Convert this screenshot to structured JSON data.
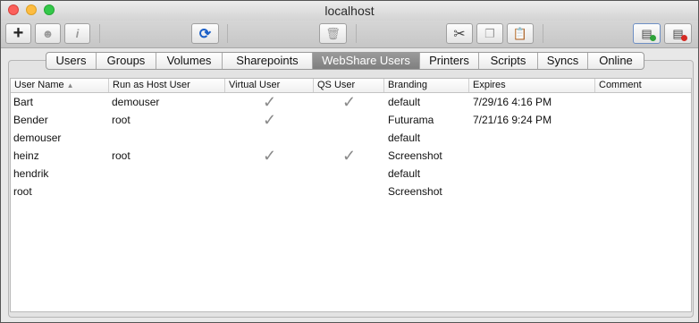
{
  "window": {
    "title": "localhost"
  },
  "toolbar": {
    "add_icon": "plus-icon",
    "user_icon": "user-silhouette-icon",
    "info_icon": "info-icon",
    "refresh_icon": "refresh-icon",
    "delete_icon": "trash-icon",
    "cut_icon": "scissors-icon",
    "copy_icon": "copy-icon",
    "paste_icon": "paste-icon",
    "connect_icon": "server-add-icon",
    "disconnect_icon": "server-remove-icon",
    "glyphs": {
      "add": "+",
      "user": "☻",
      "info": "i",
      "refresh": "⟳",
      "delete": "🗑",
      "cut": "✂",
      "copy": "❐",
      "paste": "📋",
      "connect": "▤",
      "disconnect": "▤"
    }
  },
  "tabs": [
    {
      "label": "Users",
      "selected": false
    },
    {
      "label": "Groups",
      "selected": false
    },
    {
      "label": "Volumes",
      "selected": false
    },
    {
      "label": "Sharepoints",
      "selected": false
    },
    {
      "label": "WebShare Users",
      "selected": true
    },
    {
      "label": "Printers",
      "selected": false
    },
    {
      "label": "Scripts",
      "selected": false
    },
    {
      "label": "Syncs",
      "selected": false
    },
    {
      "label": "Online",
      "selected": false
    }
  ],
  "table": {
    "columns": [
      "User Name",
      "Run as Host User",
      "Virtual User",
      "QS User",
      "Branding",
      "Expires",
      "Comment"
    ],
    "sort_indicator": "▲",
    "check_glyph": "✓",
    "rows": [
      {
        "user_name": "Bart",
        "run_as": "demouser",
        "virtual": true,
        "qs": true,
        "branding": "default",
        "expires": "7/29/16 4:16 PM",
        "comment": ""
      },
      {
        "user_name": "Bender",
        "run_as": "root",
        "virtual": true,
        "qs": false,
        "branding": "Futurama",
        "expires": "7/21/16 9:24 PM",
        "comment": ""
      },
      {
        "user_name": "demouser",
        "run_as": "",
        "virtual": false,
        "qs": false,
        "branding": "default",
        "expires": "",
        "comment": ""
      },
      {
        "user_name": "heinz",
        "run_as": "root",
        "virtual": true,
        "qs": true,
        "branding": "Screenshot",
        "expires": "",
        "comment": ""
      },
      {
        "user_name": "hendrik",
        "run_as": "",
        "virtual": false,
        "qs": false,
        "branding": "default",
        "expires": "",
        "comment": ""
      },
      {
        "user_name": "root",
        "run_as": "",
        "virtual": false,
        "qs": false,
        "branding": "Screenshot",
        "expires": "",
        "comment": ""
      }
    ]
  }
}
